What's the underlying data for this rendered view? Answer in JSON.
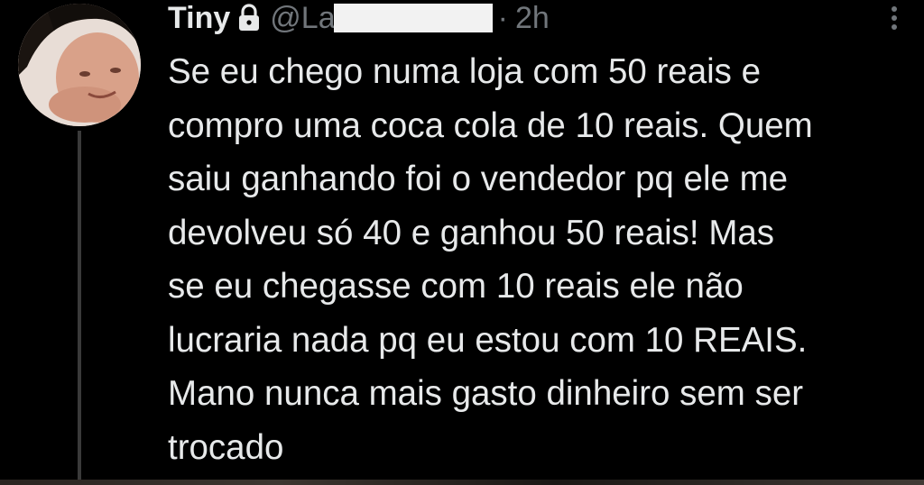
{
  "tweet": {
    "display_name": "⁨Tiny⁩",
    "handle": "@La",
    "separator": "·",
    "time": "2h",
    "text_lines": [
      "Se eu chego numa loja com 50 reais e",
      "compro uma coca cola de 10 reais. Quem",
      "saiu ganhando foi o vendedor pq ele me",
      "devolveu só 40 e ganhou 50 reais! Mas",
      "se eu chegasse com 10 reais ele não",
      "lucraria nada pq eu estou com 10 REAIS.",
      "Mano nunca mais gasto dinheiro sem ser",
      "trocado"
    ]
  },
  "icons": {
    "lock": "lock-icon",
    "more": "more-dots-icon"
  },
  "colors": {
    "background": "#000000",
    "text": "#e7e9ea",
    "secondary": "#71767b",
    "thread_line": "#3a3a3a"
  }
}
